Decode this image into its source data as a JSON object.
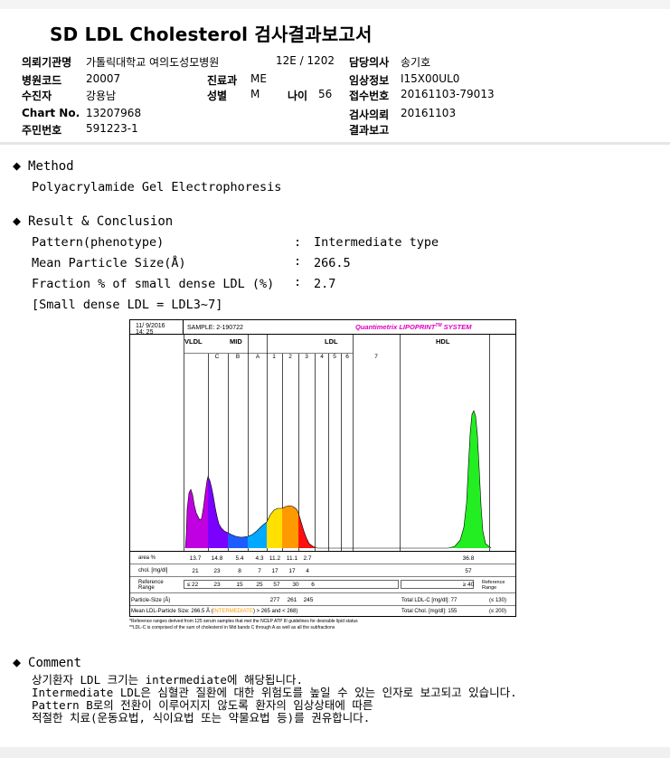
{
  "report_title": "SD LDL Cholesterol 검사결과보고서",
  "patient_info": {
    "institution_label": "의뢰기관명",
    "institution_value": "가톨릭대학교 여의도성모병원",
    "ward_value": "12E / 1202",
    "doctor_label": "담당의사",
    "doctor_value": "송기호",
    "hospital_code_label": "병원코드",
    "hospital_code_value": "20007",
    "department_label": "진료과",
    "department_value": "ME",
    "clinical_info_label": "임상정보",
    "clinical_info_value": "I15X00UL0",
    "examinee_label": "수진자",
    "examinee_value": "강용남",
    "sex_label": "성별",
    "sex_value": "M",
    "age_label": "나이",
    "age_value": "56",
    "receipt_no_label": "접수번호",
    "receipt_no_value": "20161103-79013",
    "chart_no_label": "Chart No.",
    "chart_no_value": "13207968",
    "request_date_label": "검사의뢰",
    "request_date_value": "20161103",
    "resident_no_label": "주민번호",
    "resident_no_value": "591223-1",
    "result_report_label": "결과보고",
    "result_report_value": ""
  },
  "method": {
    "heading": "Method",
    "text": "Polyacrylamide Gel Electrophoresis"
  },
  "result": {
    "heading": "Result & Conclusion",
    "rows": [
      {
        "label": "Pattern(phenotype)",
        "sep": ":",
        "value": "Intermediate type"
      },
      {
        "label": "Mean Particle Size(Å)",
        "sep": ":",
        "value": "266.5"
      },
      {
        "label": "Fraction % of small dense LDL (%)",
        "sep": ":",
        "value": "2.7"
      }
    ],
    "note": "[Small dense LDL = LDL3~7]"
  },
  "chart_data": {
    "type": "area",
    "date_line1": "11/ 9/2016",
    "date_line2": "14: 25",
    "sample_label": "SAMPLE:  2-190722",
    "brand": "Quantimetrix LIPOPRINT",
    "brand_tm": "TM",
    "brand_suffix": " SYSTEM",
    "region_labels": {
      "vldl": "VLDL",
      "mid": "MID",
      "ldl": "LDL",
      "hdl": "HDL"
    },
    "bands": [
      "C",
      "B",
      "A",
      "1",
      "2",
      "3",
      "4",
      "5",
      "6",
      "7"
    ],
    "row_labels": {
      "area": "area %",
      "chol": "chol. [mg/dl]",
      "reference": "Reference\nRange",
      "particle": "Particle-Size (Å)"
    },
    "area_values": [
      "13.7",
      "14.8",
      "5.4",
      "4.3",
      "11.2",
      "11.1",
      "2.7",
      "36.8"
    ],
    "chol_values": [
      "21",
      "23",
      "8",
      "7",
      "17",
      "17",
      "4",
      "57"
    ],
    "reference_values": [
      "≤ 22",
      "23",
      "15",
      "25",
      "57",
      "30",
      "6",
      "≥ 40"
    ],
    "particle_values": [
      "277",
      "261",
      "245"
    ],
    "total_ldl": "Total LDL-C [mg/dl]:  77",
    "total_ldl_ref": "(≤ 130)",
    "total_chol": "Total Chol. [mg/dl]:   155",
    "total_chol_ref": "(≤ 200)",
    "reference_range_right": "Reference\nRange",
    "mean_ldl_prefix": "Mean LDL-Particle Size:   266.5 Å  (",
    "mean_ldl_highlight": "INTERMEDIATE",
    "mean_ldl_suffix": ") > 265 and < 268)",
    "footnote1": "*Reference ranges derived from 125 serum samples that met the NCEP ATP III guidelines for desirable lipid status",
    "footnote2": "**LDL-C is comprised of the sum of cholesterol in Mid bands C through A as well as all the subfractions",
    "colors": {
      "vldl": "#c000e0",
      "midc": "#7a00ff",
      "midb": "#1c5cff",
      "mida": "#00a8ff",
      "ldl1": "#ffe000",
      "ldl2": "#ff9900",
      "ldl3": "#ff1010",
      "hdl": "#22ee22",
      "brand": "#e000c0",
      "highlight": "#ff9900"
    }
  },
  "comment": {
    "heading": "Comment",
    "lines": [
      "상기환자 LDL 크기는 intermediate에 해당됩니다.",
      "Intermediate LDL은 심혈관 질환에 대한 위험도를 높일 수 있는 인자로 보고되고 있습니다.",
      "Pattern B로의 전환이 이루어지지 않도록 환자의 임상상태에 따른",
      "적절한 치료(운동요법, 식이요법 또는 약물요법 등)를 권유합니다."
    ]
  }
}
